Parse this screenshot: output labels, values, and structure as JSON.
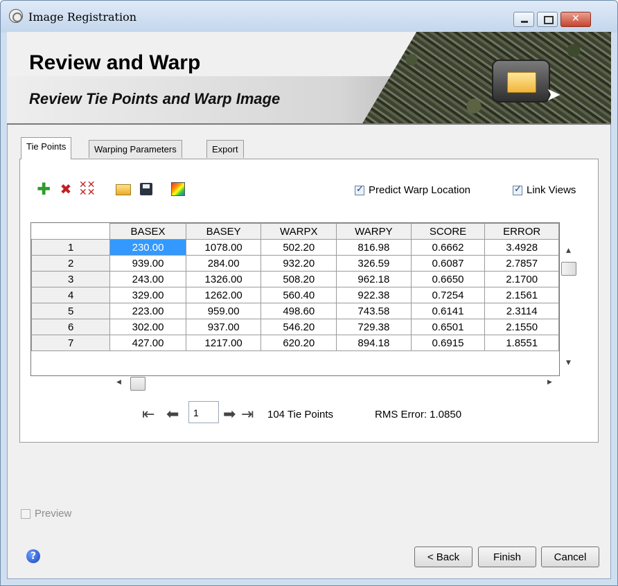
{
  "window": {
    "title": "Image Registration"
  },
  "banner": {
    "title": "Review and Warp",
    "subtitle": "Review Tie Points and Warp Image"
  },
  "tabs": [
    {
      "label": "Tie Points",
      "active": true
    },
    {
      "label": "Warping Parameters",
      "active": false
    },
    {
      "label": "Export",
      "active": false
    }
  ],
  "toolbar": {
    "icons": [
      "add-icon",
      "delete-icon",
      "delete-all-icon",
      "open-icon",
      "save-icon",
      "color-palette-icon"
    ]
  },
  "options": {
    "predict_label": "Predict Warp Location",
    "predict_checked": true,
    "link_label": "Link Views",
    "link_checked": true
  },
  "table": {
    "columns": [
      "BASEX",
      "BASEY",
      "WARPX",
      "WARPY",
      "SCORE",
      "ERROR"
    ],
    "rows": [
      {
        "id": "1",
        "cells": [
          "230.00",
          "1078.00",
          "502.20",
          "816.98",
          "0.6662",
          "3.4928"
        ]
      },
      {
        "id": "2",
        "cells": [
          "939.00",
          "284.00",
          "932.20",
          "326.59",
          "0.6087",
          "2.7857"
        ]
      },
      {
        "id": "3",
        "cells": [
          "243.00",
          "1326.00",
          "508.20",
          "962.18",
          "0.6650",
          "2.1700"
        ]
      },
      {
        "id": "4",
        "cells": [
          "329.00",
          "1262.00",
          "560.40",
          "922.38",
          "0.7254",
          "2.1561"
        ]
      },
      {
        "id": "5",
        "cells": [
          "223.00",
          "959.00",
          "498.60",
          "743.58",
          "0.6141",
          "2.3114"
        ]
      },
      {
        "id": "6",
        "cells": [
          "302.00",
          "937.00",
          "546.20",
          "729.38",
          "0.6501",
          "2.1550"
        ]
      },
      {
        "id": "7",
        "cells": [
          "427.00",
          "1217.00",
          "620.20",
          "894.18",
          "0.6915",
          "1.8551"
        ]
      }
    ],
    "selected_cell": {
      "row": 0,
      "col": 0
    },
    "selected_color": "#3399ff"
  },
  "navigator": {
    "page_value": "1",
    "count_text": "104 Tie Points",
    "rms_text": "RMS Error: 1.0850"
  },
  "preview": {
    "label": "Preview",
    "checked": false,
    "enabled": false
  },
  "buttons": {
    "back": "< Back",
    "finish": "Finish",
    "cancel": "Cancel"
  }
}
